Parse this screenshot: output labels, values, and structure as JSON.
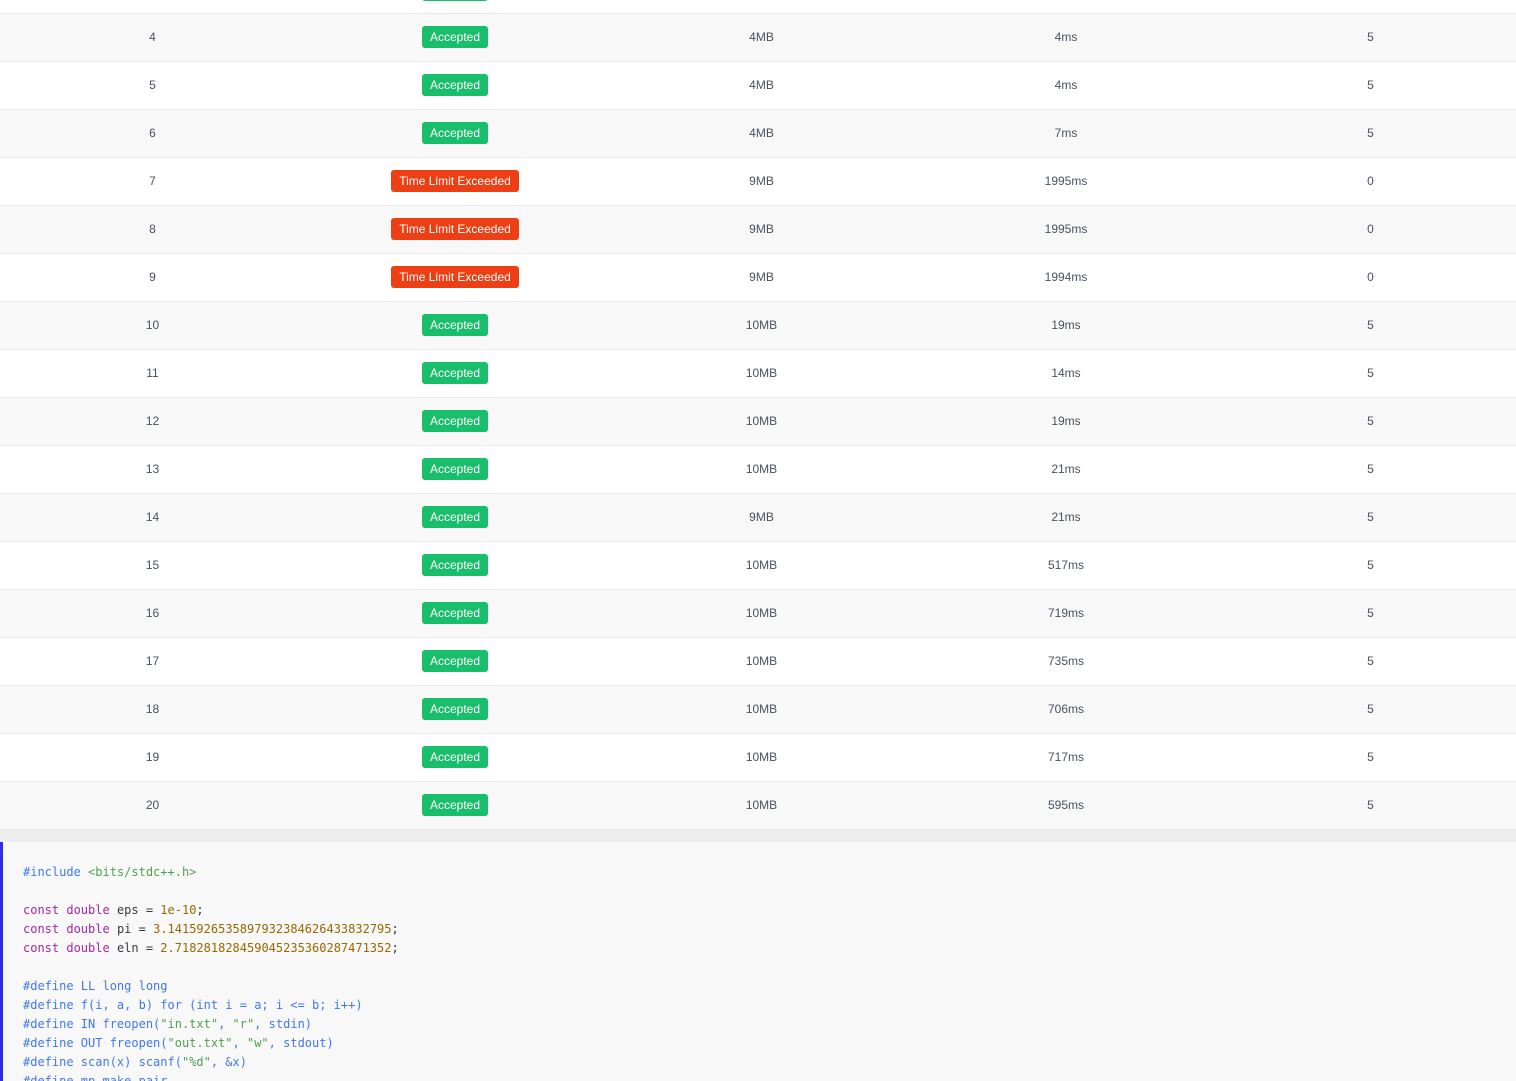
{
  "results": [
    {
      "id": "4",
      "status": "Accepted",
      "status_type": "ac",
      "memory": "4MB",
      "time": "4ms",
      "score": "5"
    },
    {
      "id": "5",
      "status": "Accepted",
      "status_type": "ac",
      "memory": "4MB",
      "time": "4ms",
      "score": "5"
    },
    {
      "id": "6",
      "status": "Accepted",
      "status_type": "ac",
      "memory": "4MB",
      "time": "7ms",
      "score": "5"
    },
    {
      "id": "7",
      "status": "Time Limit Exceeded",
      "status_type": "tle",
      "memory": "9MB",
      "time": "1995ms",
      "score": "0"
    },
    {
      "id": "8",
      "status": "Time Limit Exceeded",
      "status_type": "tle",
      "memory": "9MB",
      "time": "1995ms",
      "score": "0"
    },
    {
      "id": "9",
      "status": "Time Limit Exceeded",
      "status_type": "tle",
      "memory": "9MB",
      "time": "1994ms",
      "score": "0"
    },
    {
      "id": "10",
      "status": "Accepted",
      "status_type": "ac",
      "memory": "10MB",
      "time": "19ms",
      "score": "5"
    },
    {
      "id": "11",
      "status": "Accepted",
      "status_type": "ac",
      "memory": "10MB",
      "time": "14ms",
      "score": "5"
    },
    {
      "id": "12",
      "status": "Accepted",
      "status_type": "ac",
      "memory": "10MB",
      "time": "19ms",
      "score": "5"
    },
    {
      "id": "13",
      "status": "Accepted",
      "status_type": "ac",
      "memory": "10MB",
      "time": "21ms",
      "score": "5"
    },
    {
      "id": "14",
      "status": "Accepted",
      "status_type": "ac",
      "memory": "9MB",
      "time": "21ms",
      "score": "5"
    },
    {
      "id": "15",
      "status": "Accepted",
      "status_type": "ac",
      "memory": "10MB",
      "time": "517ms",
      "score": "5"
    },
    {
      "id": "16",
      "status": "Accepted",
      "status_type": "ac",
      "memory": "10MB",
      "time": "719ms",
      "score": "5"
    },
    {
      "id": "17",
      "status": "Accepted",
      "status_type": "ac",
      "memory": "10MB",
      "time": "735ms",
      "score": "5"
    },
    {
      "id": "18",
      "status": "Accepted",
      "status_type": "ac",
      "memory": "10MB",
      "time": "706ms",
      "score": "5"
    },
    {
      "id": "19",
      "status": "Accepted",
      "status_type": "ac",
      "memory": "10MB",
      "time": "717ms",
      "score": "5"
    },
    {
      "id": "20",
      "status": "Accepted",
      "status_type": "ac",
      "memory": "10MB",
      "time": "595ms",
      "score": "5"
    }
  ],
  "colors": {
    "accepted": "#19be6b",
    "time_limit_exceeded": "#ed3f14",
    "code_border": "#2d2df0"
  },
  "code": {
    "lines": [
      "#include <bits/stdc++.h>",
      "",
      "const double eps = 1e-10;",
      "const double pi = 3.1415926535897932384626433832795;",
      "const double eln = 2.718281828459045235360287471352;",
      "",
      "#define LL long long",
      "#define f(i, a, b) for (int i = a; i <= b; i++)",
      "#define IN freopen(\"in.txt\", \"r\", stdin)",
      "#define OUT freopen(\"out.txt\", \"w\", stdout)",
      "#define scan(x) scanf(\"%d\", &x)",
      "#define mp make_pair"
    ]
  }
}
